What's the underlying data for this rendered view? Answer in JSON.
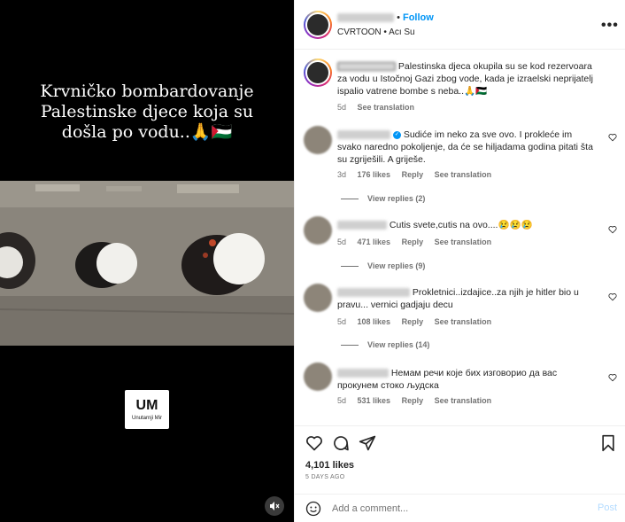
{
  "media": {
    "caption": "Krvničko bombardovanje\nPalestinske djece koja su\ndošla po vodu..🙏🇵🇸",
    "brand_title": "UM",
    "brand_subtitle": "Unutarnji Mir",
    "mute_icon": "muted-speaker-icon"
  },
  "header": {
    "username_hidden": "",
    "dot": "•",
    "follow_label": "Follow",
    "audio_line": "CVRTOON • Acı Su",
    "more_icon": "•••"
  },
  "caption": {
    "text": "Palestinska djeca okupila su se kod rezervoara za vodu u Istočnoj Gazi zbog vode, kada je izraelski neprijatelj ispalio vatrene bombe s neba..🙏🇵🇸",
    "age": "5d",
    "see_translation": "See translation"
  },
  "comments": [
    {
      "text": "Sudiće im neko za sve ovo. I prokleće im svako naredno pokoljenje, da će se hiljadama godina pitati šta su zgriješili. A griješe.",
      "age": "3d",
      "likes": "176 likes",
      "reply": "Reply",
      "translate": "See translation",
      "replies": "View replies (2)",
      "verified": true
    },
    {
      "text": "Cutis svete,cutis na ovo....😢😢😢",
      "age": "5d",
      "likes": "471 likes",
      "reply": "Reply",
      "translate": "See translation",
      "replies": "View replies (9)",
      "verified": false
    },
    {
      "text": "Prokletnici..izdajice..za njih je hitler bio u pravu... vernici gadjaju decu",
      "age": "5d",
      "likes": "108 likes",
      "reply": "Reply",
      "translate": "See translation",
      "replies": "View replies (14)",
      "verified": false
    },
    {
      "text": "Немам речи које бих изговорио да вас прокунем стоко људска",
      "age": "5d",
      "likes": "531 likes",
      "reply": "Reply",
      "translate": "See translation",
      "replies": "",
      "verified": false
    }
  ],
  "actions": {
    "like_icon": "heart-icon",
    "comment_icon": "comment-icon",
    "share_icon": "send-icon",
    "save_icon": "bookmark-icon"
  },
  "stats": {
    "likes": "4,101 likes",
    "time_ago": "5 DAYS AGO"
  },
  "add_comment": {
    "placeholder": "Add a comment...",
    "post_label": "Post",
    "emoji_icon": "smiley-icon"
  },
  "colors": {
    "accent": "#0095f6",
    "post_disabled": "#b3dbff",
    "muted_text": "#737373"
  }
}
